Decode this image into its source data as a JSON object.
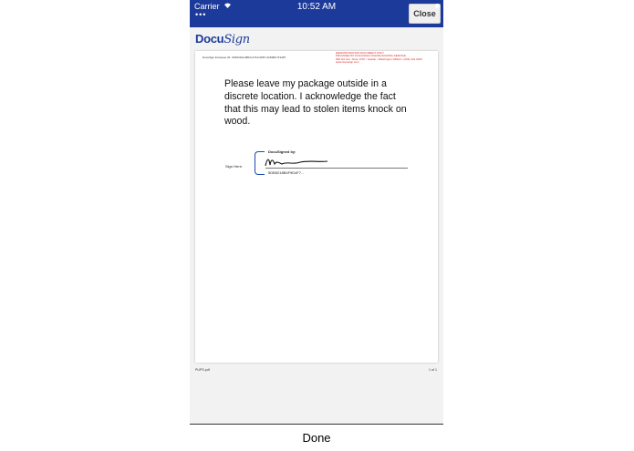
{
  "status_bar": {
    "carrier": "Carrier",
    "time": "10:52 AM",
    "dots": "•••"
  },
  "header": {
    "close_label": "Close"
  },
  "logo": {
    "docu": "Docu",
    "sign": "Sign"
  },
  "document": {
    "envelope_id": "DocuSign Envelope ID: C5493194-88F0-47F2-9687-3A53BC7F1287",
    "demo_notice": [
      "DEMONSTRATION DOCUMENT ONLY",
      "PROVIDED BY DOCUSIGN ONLINE SIGNING SERVICE",
      "999 3rd Ave, Suite 1700 • Seattle • Washington 98104 • (206) 219-0200",
      "www.docusign.com"
    ],
    "body": "Please leave my package outside in a discrete location.  I acknowledge the fact that this may lead to stolen items knock on wood.",
    "sign_here_label": "Sign Here:",
    "docusigned_by": "DocuSigned by:",
    "signature_id": "5DB5218B4F9D4F7..."
  },
  "footer": {
    "filename": "PUPS.pdf",
    "page_count": "1 of 1"
  },
  "toolbar": {
    "done_label": "Done"
  },
  "colors": {
    "brand_blue": "#1c3a9a",
    "demo_red": "#d92b2b"
  }
}
